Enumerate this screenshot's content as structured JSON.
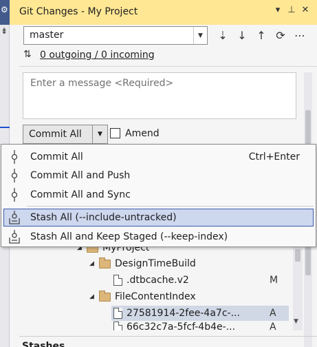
{
  "panel": {
    "title": "Git Changes - My Project",
    "titlebar_icons": [
      "chevron-down-icon",
      "pin-icon",
      "close-icon"
    ]
  },
  "branch": {
    "selected": "master"
  },
  "toolbar": {
    "icons": [
      "fetch-icon",
      "pull-icon",
      "push-icon",
      "sync-icon",
      "more-icon"
    ]
  },
  "sync": {
    "label": "0 outgoing / 0 incoming"
  },
  "commit": {
    "message_placeholder": "Enter a message <Required>",
    "commit_button": "Commit All",
    "amend_label": "Amend"
  },
  "menu": {
    "items": [
      {
        "label": "Commit All",
        "shortcut": "Ctrl+Enter",
        "icon": "commit-icon"
      },
      {
        "label": "Commit All and Push",
        "shortcut": "",
        "icon": "commit-icon"
      },
      {
        "label": "Commit All and Sync",
        "shortcut": "",
        "icon": "commit-icon"
      },
      {
        "label": "Stash All (--include-untracked)",
        "shortcut": "",
        "icon": "stash-icon"
      },
      {
        "label": "Stash All and Keep Staged (--keep-index)",
        "shortcut": "",
        "icon": "stash-icon"
      }
    ],
    "highlighted_index": 3
  },
  "tree": {
    "rows": [
      {
        "label": "MyProject",
        "type": "folder",
        "status": ""
      },
      {
        "label": "DesignTimeBuild",
        "type": "folder",
        "status": ""
      },
      {
        "label": ".dtbcache.v2",
        "type": "file",
        "status": "M"
      },
      {
        "label": "FileContentIndex",
        "type": "folder",
        "status": ""
      },
      {
        "label": "27581914-2fee-4a7c-...",
        "type": "file",
        "status": "A"
      },
      {
        "label": "66c32c7a-5fcf-4b4e-...",
        "type": "file",
        "status": "A"
      }
    ]
  },
  "stashes": {
    "label": "Stashes"
  }
}
